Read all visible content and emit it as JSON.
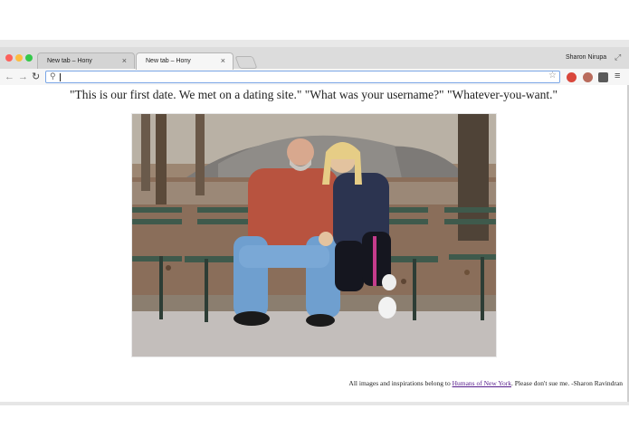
{
  "browser": {
    "tabs": [
      {
        "title": "New tab – Hony",
        "close": "×"
      },
      {
        "title": "New tab – Hony",
        "close": "×"
      }
    ],
    "profile_name": "Sharon Nirupa",
    "omnibox": {
      "value": ""
    }
  },
  "page": {
    "quote": "\"This is our first date. We met on a dating site.\" \"What was your username?\" \"Whatever-you-want.\"",
    "photo_alt": "Couple sitting on a park bench",
    "credit": {
      "before": "All images and inspirations belong to ",
      "link": "Humans of New York",
      "after": ". Please don't sue me. -Sharon Ravindran"
    }
  },
  "colors": {
    "link": "#551a8b",
    "shirt": "#b8533f",
    "jacket": "#2c3450",
    "bench": "#3f5a4c"
  }
}
